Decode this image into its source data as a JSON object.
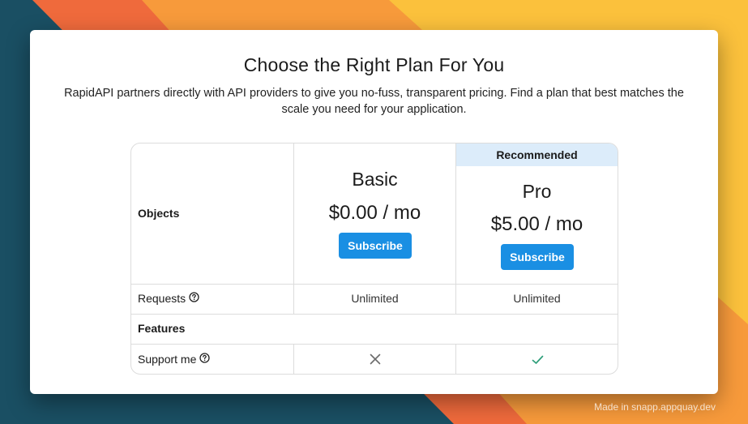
{
  "pricing": {
    "title": "Choose the Right Plan For You",
    "subtitle": "RapidAPI partners directly with API providers to give you no-fuss, transparent pricing. Find a plan that best matches the scale you need for your application."
  },
  "table": {
    "objects_label": "Objects",
    "recommended_label": "Recommended",
    "plans": [
      {
        "name": "Basic",
        "price": "$0.00 / mo",
        "subscribe_label": "Subscribe"
      },
      {
        "name": "Pro",
        "price": "$5.00 / mo",
        "subscribe_label": "Subscribe"
      }
    ],
    "requests_label": "Requests",
    "requests_values": [
      "Unlimited",
      "Unlimited"
    ],
    "features_label": "Features",
    "support_label": "Support me",
    "support_values": [
      "x-icon",
      "check-icon"
    ]
  },
  "colors": {
    "accent": "#1a8fe3",
    "recommended_bg": "#dcecfa",
    "check": "#2e9e7a",
    "cross": "#6b6b6b"
  },
  "watermark": "Made in snapp.appquay.dev"
}
